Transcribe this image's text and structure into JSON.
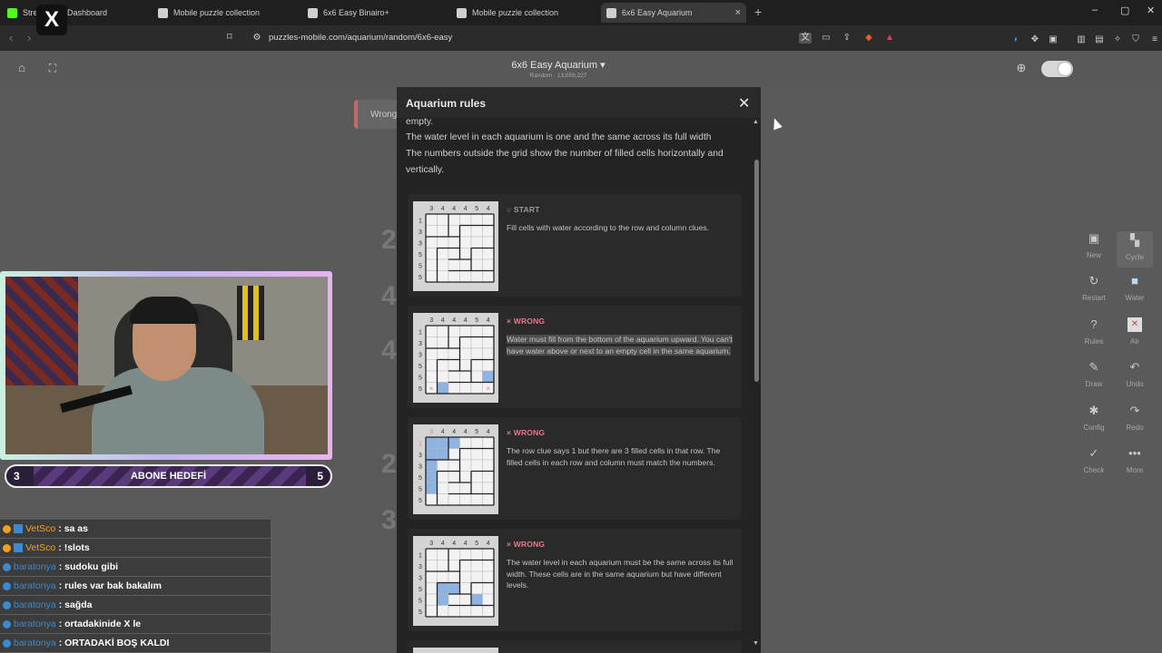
{
  "browser": {
    "tabs": [
      {
        "label": "Stre",
        "favicon_color": "#53fc18"
      },
      {
        "label": "Dashboard",
        "favicon_color": "#1f1f1f"
      },
      {
        "label": "Mobile puzzle collection",
        "favicon_color": "#cfcfcf"
      },
      {
        "label": "6x6 Easy Binairo+",
        "favicon_color": "#cfcfcf"
      },
      {
        "label": "Mobile puzzle collection",
        "favicon_color": "#cfcfcf"
      },
      {
        "label": "6x6 Easy Aquarium",
        "favicon_color": "#cfcfcf"
      }
    ],
    "tab_close": "×",
    "new_tab": "+",
    "url": "puzzles-mobile.com/aquarium/random/6x6-easy",
    "window_controls": [
      "–",
      "▢",
      "✕"
    ]
  },
  "page": {
    "title": "6x6 Easy Aquarium",
    "title_caret": "▾",
    "subtitle": "Random · 13,059,227",
    "home_icon": "home-icon",
    "fullscreen_icon": "fullscreen-icon",
    "zoom_icon": "zoom-icon"
  },
  "background": {
    "wrong_chip": "Wrong",
    "clue_numbers": [
      "2",
      "4",
      "4",
      "2",
      "3"
    ]
  },
  "modal": {
    "title": "Aquarium rules",
    "close": "✕",
    "rules": [
      "empty.",
      "The water level in each aquarium is one and the same across its full width",
      "The numbers outside the grid show the number of filled cells horizontally and vertically."
    ],
    "cards": [
      {
        "status": "○ START",
        "status_kind": "start",
        "desc": "Fill cells with water according to the row and column clues."
      },
      {
        "status": "× WRONG",
        "status_kind": "wrong",
        "desc": "Water must fill from the bottom of the aquarium upward. You can't have water above or next to an empty cell in the same aquarium."
      },
      {
        "status": "× WRONG",
        "status_kind": "wrong",
        "desc": "The row clue says 1 but there are 3 filled cells in that row. The filled cells in each row and column must match the numbers."
      },
      {
        "status": "× WRONG",
        "status_kind": "wrong",
        "desc": "The water level in each aquarium must be the same across its full width. These cells are in the same aquarium but have different levels."
      }
    ],
    "thumb": {
      "col_clues": [
        "3",
        "4",
        "4",
        "4",
        "5",
        "4"
      ],
      "row_clues": [
        "1",
        "3",
        "3",
        "5",
        "5",
        "5"
      ],
      "water_color": "#8fb3e0",
      "error_color": "#e27a8a"
    }
  },
  "tools": [
    {
      "label": "New",
      "icon": "new-icon",
      "glyph": "▣"
    },
    {
      "label": "Cycle",
      "icon": "cycle-icon",
      "glyph": "▚"
    },
    {
      "label": "Restart",
      "icon": "restart-icon",
      "glyph": "↻"
    },
    {
      "label": "Water",
      "icon": "water-icon",
      "glyph": "■"
    },
    {
      "label": "Rules",
      "icon": "rules-icon",
      "glyph": "?"
    },
    {
      "label": "Air",
      "icon": "air-icon",
      "glyph": "✕"
    },
    {
      "label": "Draw",
      "icon": "draw-icon",
      "glyph": "✎"
    },
    {
      "label": "Undo",
      "icon": "undo-icon",
      "glyph": "↶"
    },
    {
      "label": "Config",
      "icon": "config-icon",
      "glyph": "✱"
    },
    {
      "label": "Redo",
      "icon": "redo-icon",
      "glyph": "↷"
    },
    {
      "label": "Check",
      "icon": "check-icon",
      "glyph": "✓"
    },
    {
      "label": "More",
      "icon": "more-icon",
      "glyph": "•••"
    }
  ],
  "stream": {
    "goal_current": "3",
    "goal_label": "ABONE HEDEFİ",
    "goal_target": "5",
    "logo": "X"
  },
  "chat": [
    {
      "user": "VetSco",
      "text": ": sa as",
      "color": "#f0a020",
      "badge": "#f0a020"
    },
    {
      "user": "VetSco",
      "text": ": !slots",
      "color": "#f0a020",
      "badge": "#f0a020"
    },
    {
      "user": "baratonya",
      "text": ": sudoku gibi",
      "color": "#3a8ad0",
      "badge": "#3a8ad0"
    },
    {
      "user": "baratonya",
      "text": ": rules var bak bakalım",
      "color": "#3a8ad0",
      "badge": "#3a8ad0"
    },
    {
      "user": "baratonya",
      "text": ": sağda",
      "color": "#3a8ad0",
      "badge": "#3a8ad0"
    },
    {
      "user": "baratonya",
      "text": ": ortadakinide X le",
      "color": "#3a8ad0",
      "badge": "#3a8ad0"
    },
    {
      "user": "baratonya",
      "text": ": ORTADAKİ BOŞ KALDI",
      "color": "#3a8ad0",
      "badge": "#3a8ad0"
    }
  ]
}
